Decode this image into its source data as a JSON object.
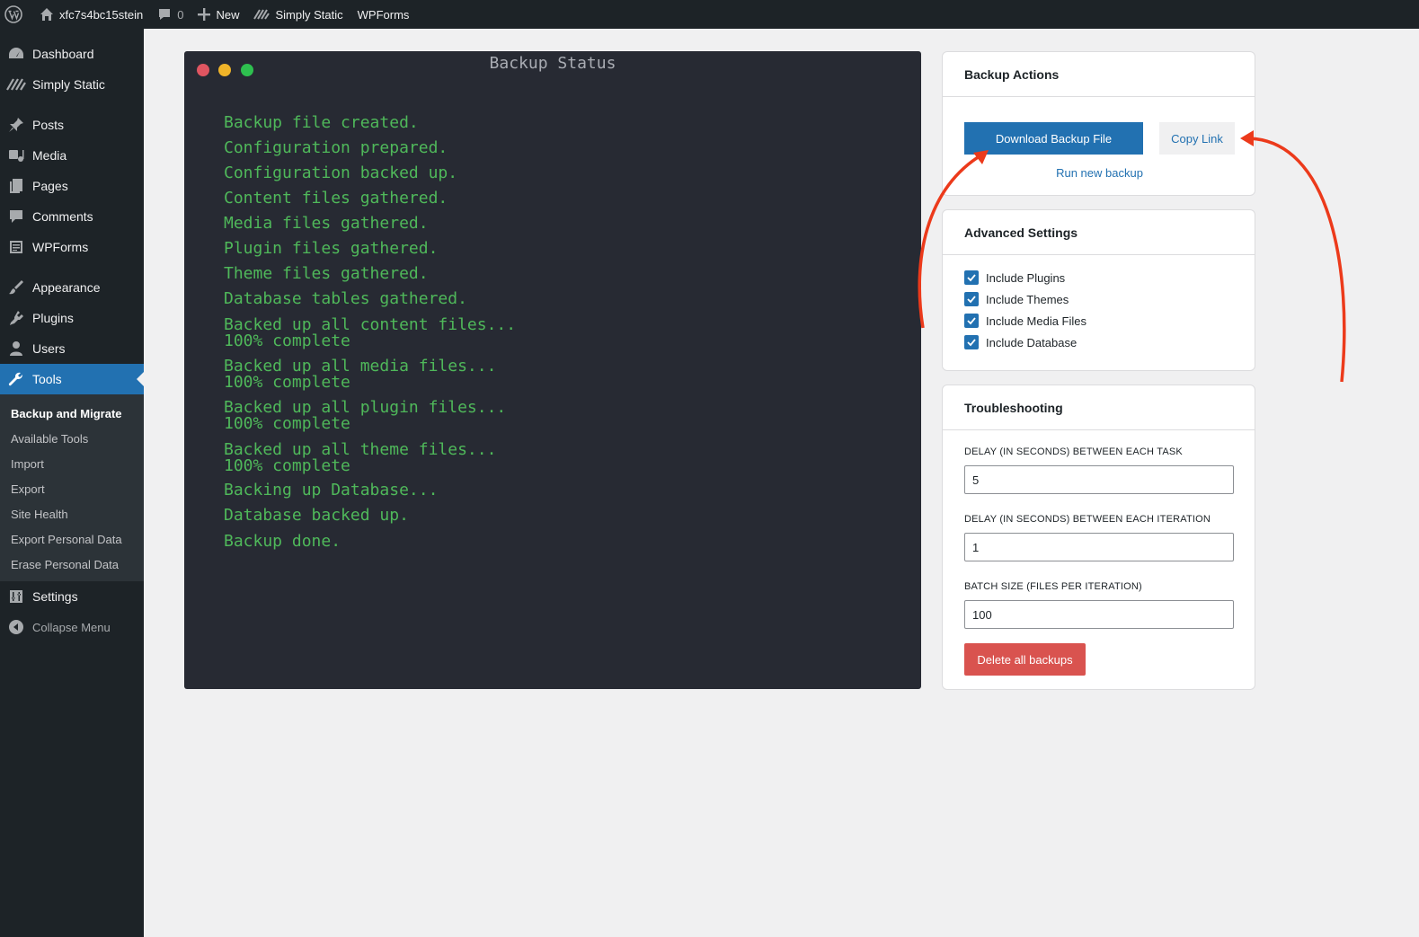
{
  "adminbar": {
    "site_name": "xfc7s4bc15stein",
    "comment_count": "0",
    "new_label": "New",
    "simply_static_label": "Simply Static",
    "wpforms_label": "WPForms"
  },
  "sidebar": {
    "items": [
      {
        "label": "Dashboard",
        "icon": "dashboard-icon"
      },
      {
        "label": "Simply Static",
        "icon": "simply-static-icon"
      },
      {
        "label": "Posts",
        "icon": "pin-icon"
      },
      {
        "label": "Media",
        "icon": "media-icon"
      },
      {
        "label": "Pages",
        "icon": "pages-icon"
      },
      {
        "label": "Comments",
        "icon": "comment-icon"
      },
      {
        "label": "WPForms",
        "icon": "form-icon"
      },
      {
        "label": "Appearance",
        "icon": "brush-icon"
      },
      {
        "label": "Plugins",
        "icon": "plug-icon"
      },
      {
        "label": "Users",
        "icon": "user-icon"
      },
      {
        "label": "Tools",
        "icon": "wrench-icon"
      }
    ],
    "submenu": [
      "Backup and Migrate",
      "Available Tools",
      "Import",
      "Export",
      "Site Health",
      "Export Personal Data",
      "Erase Personal Data"
    ],
    "settings_label": "Settings",
    "collapse_label": "Collapse Menu"
  },
  "terminal": {
    "title": "Backup Status",
    "lines": [
      "Backup file created.",
      "Configuration prepared.",
      "Configuration backed up.",
      "Content files gathered.",
      "Media files gathered.",
      "Plugin files gathered.",
      "Theme files gathered.",
      "Database tables gathered.",
      "Backed up all content files...",
      "100% complete",
      "Backed up all media files...",
      "100% complete",
      "Backed up all plugin files...",
      "100% complete",
      "Backed up all theme files...",
      "100% complete",
      "Backing up Database...",
      "Database backed up.",
      "Backup done."
    ]
  },
  "backup_actions": {
    "title": "Backup Actions",
    "download_label": "Download Backup File",
    "copy_label": "Copy Link",
    "run_new_label": "Run new backup"
  },
  "advanced_settings": {
    "title": "Advanced Settings",
    "options": [
      {
        "label": "Include Plugins",
        "checked": true
      },
      {
        "label": "Include Themes",
        "checked": true
      },
      {
        "label": "Include Media Files",
        "checked": true
      },
      {
        "label": "Include Database",
        "checked": true
      }
    ]
  },
  "troubleshooting": {
    "title": "Troubleshooting",
    "task_delay_label": "DELAY (IN SECONDS) BETWEEN EACH TASK",
    "task_delay_value": "5",
    "iteration_delay_label": "DELAY (IN SECONDS) BETWEEN EACH ITERATION",
    "iteration_delay_value": "1",
    "batch_size_label": "BATCH SIZE (FILES PER ITERATION)",
    "batch_size_value": "100",
    "delete_label": "Delete all backups"
  },
  "colors": {
    "accent": "#2271b1",
    "terminal_bg": "#272a33",
    "terminal_text": "#4fb85a",
    "danger": "#d9534f",
    "annotation_arrow": "#ec3a1b"
  }
}
